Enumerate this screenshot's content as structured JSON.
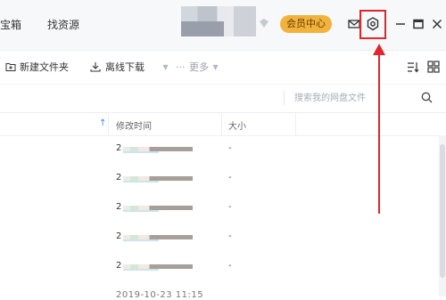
{
  "header": {
    "nav": {
      "vault": "宝箱",
      "resources": "找资源"
    },
    "vip_label": "会员中心"
  },
  "toolbar": {
    "new_folder": "新建文件夹",
    "offline_download": "离线下载",
    "more": "更多",
    "more_dots": "···"
  },
  "search": {
    "placeholder": "搜索我的网盘文件",
    "value": ""
  },
  "table": {
    "columns": {
      "modified": "修改时间",
      "size": "大小"
    },
    "rows": [
      {
        "time": "2",
        "size": "-"
      },
      {
        "time": "2",
        "size": "-"
      },
      {
        "time": "2",
        "size": "-"
      },
      {
        "time": "2",
        "size": "-"
      },
      {
        "time": "2",
        "size": "-"
      }
    ],
    "partial_row": "2019-10-23 11:15"
  },
  "icons": {
    "mail": "mail-icon",
    "settings": "settings-icon",
    "minimize": "minimize-icon",
    "maximize": "maximize-icon",
    "close": "close-icon",
    "sort": "sort-icon",
    "grid": "grid-view-icon",
    "search": "search-icon",
    "upload": "arrow-up-icon"
  },
  "colors": {
    "accent": "#3a86ff",
    "vip": "#f2b33d",
    "highlight": "#e0262b"
  }
}
